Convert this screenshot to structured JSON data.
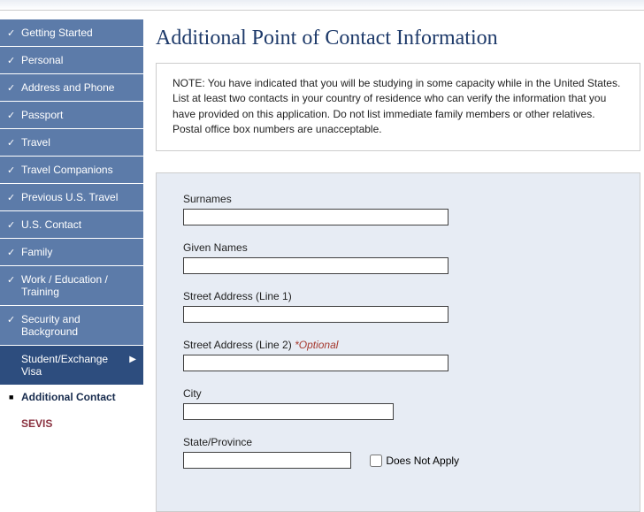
{
  "nav": {
    "items": [
      "Getting Started",
      "Personal",
      "Address and Phone",
      "Passport",
      "Travel",
      "Travel Companions",
      "Previous U.S. Travel",
      "U.S. Contact",
      "Family",
      "Work / Education / Training",
      "Security and Background"
    ],
    "active": "Student/Exchange Visa",
    "sub_current": "Additional Contact",
    "sub_sevis": "SEVIS"
  },
  "page": {
    "title": "Additional Point of Contact Information",
    "note": "NOTE: You have indicated that you will be studying in some capacity while in the United States. List at least two contacts in your country of residence who can verify the information that you have provided on this application. Do not list immediate family members or other relatives. Postal office box numbers are unacceptable."
  },
  "form": {
    "surnames_label": "Surnames",
    "given_names_label": "Given Names",
    "street1_label": "Street Address (Line 1)",
    "street2_label": "Street Address (Line 2) ",
    "street2_optional": "*Optional",
    "city_label": "City",
    "state_label": "State/Province",
    "does_not_apply": "Does Not Apply"
  }
}
